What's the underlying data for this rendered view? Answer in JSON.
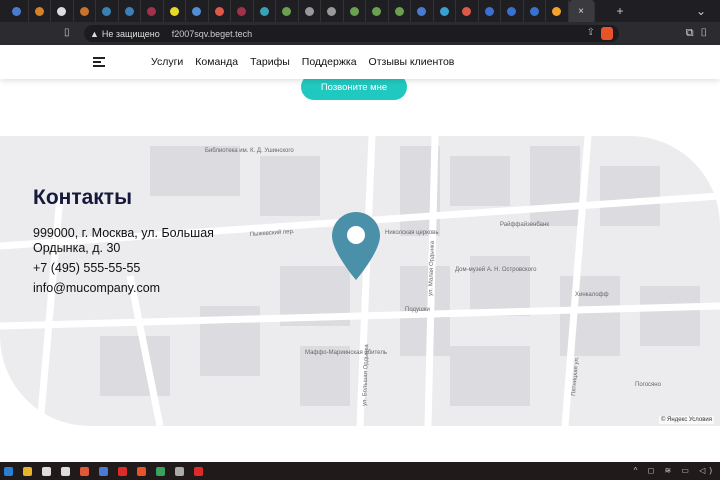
{
  "browser": {
    "tab_colors": [
      "#4a7bd0",
      "#d4812a",
      "#ddd",
      "#c9722a",
      "#3a7fb5",
      "#3a7fb5",
      "#a0324a",
      "#e7d92a",
      "#4f8fd6",
      "#e0584a",
      "#a0324a",
      "#3aa0b5",
      "#6aa050",
      "#999",
      "#999",
      "#6aa050",
      "#6aa050",
      "#6aa050",
      "#4a7bd0",
      "#3aa0d0",
      "#e0584a",
      "#3a70d0",
      "#3a70d0",
      "#3a70d0",
      "#f2a32a"
    ],
    "active_tab_close": "×",
    "new_tab": "+",
    "tab_menu": "⌄",
    "security_label": "Не защищено",
    "url": "f2007sqv.beget.tech"
  },
  "nav": {
    "items": [
      "Услуги",
      "Команда",
      "Тарифы",
      "Поддержка",
      "Отзывы клиентов"
    ]
  },
  "cta": {
    "label": "Позвоните мне"
  },
  "contacts": {
    "title": "Контакты",
    "address": "999000, г. Москва, ул. Большая Ордынка, д. 30",
    "phone": "+7 (495) 555-55-55",
    "email": "info@mucompany.com"
  },
  "map": {
    "copyright": "© Яндекс  Условия",
    "labels": [
      "ул. Большая Ордынка",
      "ул. Малая Ордынка",
      "Пятницкая ул.",
      "Пыжевский пер.",
      "Николская церковь",
      "Маффо-Мариинская обитель",
      "Подушки",
      "Библиотека им. К. Д. Ушинского",
      "Дом-музей А. Н. Островского",
      "Хинкалофф",
      "Райффайзенбанк",
      "Погосяно"
    ],
    "pin_color": "#4a90a8"
  },
  "taskbar": {
    "colors": [
      "#2a7fd0",
      "#e8b42a",
      "#ddd",
      "#ddd",
      "#e0583a",
      "#4a7bd0",
      "#e02a2a",
      "#e8532b",
      "#3aa060",
      "#aaa",
      "#e02a2a"
    ],
    "tray": "^ ◻ ≋ ▭ ◁)"
  }
}
